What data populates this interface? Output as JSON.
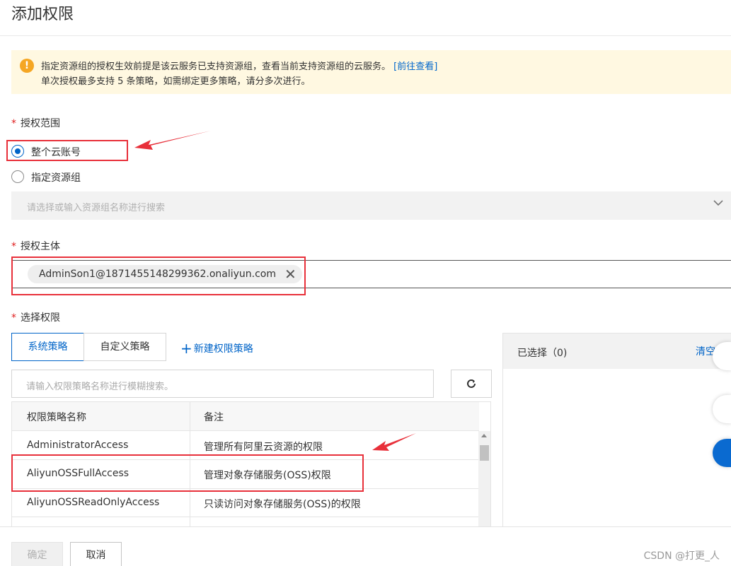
{
  "dialog": {
    "title": "添加权限"
  },
  "notice": {
    "line1": "指定资源组的授权生效前提是该云服务已支持资源组，查看当前支持资源组的云服务。",
    "link": "[前往查看]",
    "line2": "单次授权最多支持 5 条策略，如需绑定更多策略，请分多次进行。",
    "icon": "warning-icon"
  },
  "scope": {
    "required_mark": "*",
    "label": "授权范围",
    "options": [
      {
        "label": "整个云账号",
        "selected": true
      },
      {
        "label": "指定资源组",
        "selected": false
      }
    ],
    "resource_group_placeholder": "请选择或输入资源组名称进行搜索"
  },
  "principal": {
    "required_mark": "*",
    "label": "授权主体",
    "tag": "AdminSon1@1871455148299362.onaliyun.com"
  },
  "permissions": {
    "required_mark": "*",
    "label": "选择权限",
    "tabs": [
      {
        "label": "系统策略",
        "active": true
      },
      {
        "label": "自定义策略",
        "active": false
      }
    ],
    "new_policy": "新建权限策略",
    "search_placeholder": "请输入权限策略名称进行模糊搜索。",
    "table": {
      "headers": [
        "权限策略名称",
        "备注"
      ],
      "rows": [
        {
          "name": "AdministratorAccess",
          "note": "管理所有阿里云资源的权限"
        },
        {
          "name": "AliyunOSSFullAccess",
          "note": "管理对象存储服务(OSS)权限"
        },
        {
          "name": "AliyunOSSReadOnlyAccess",
          "note": "只读访问对象存储服务(OSS)的权限"
        }
      ]
    },
    "selected_panel": {
      "label": "已选择（0)",
      "clear": "清空"
    }
  },
  "footer": {
    "ok": "确定",
    "cancel": "取消",
    "watermark": "CSDN @打更_人"
  },
  "colors": {
    "primary": "#0064c8",
    "annotation_red": "#e8303a",
    "notice_bg": "#fff8e1",
    "warning": "#f5a623"
  }
}
